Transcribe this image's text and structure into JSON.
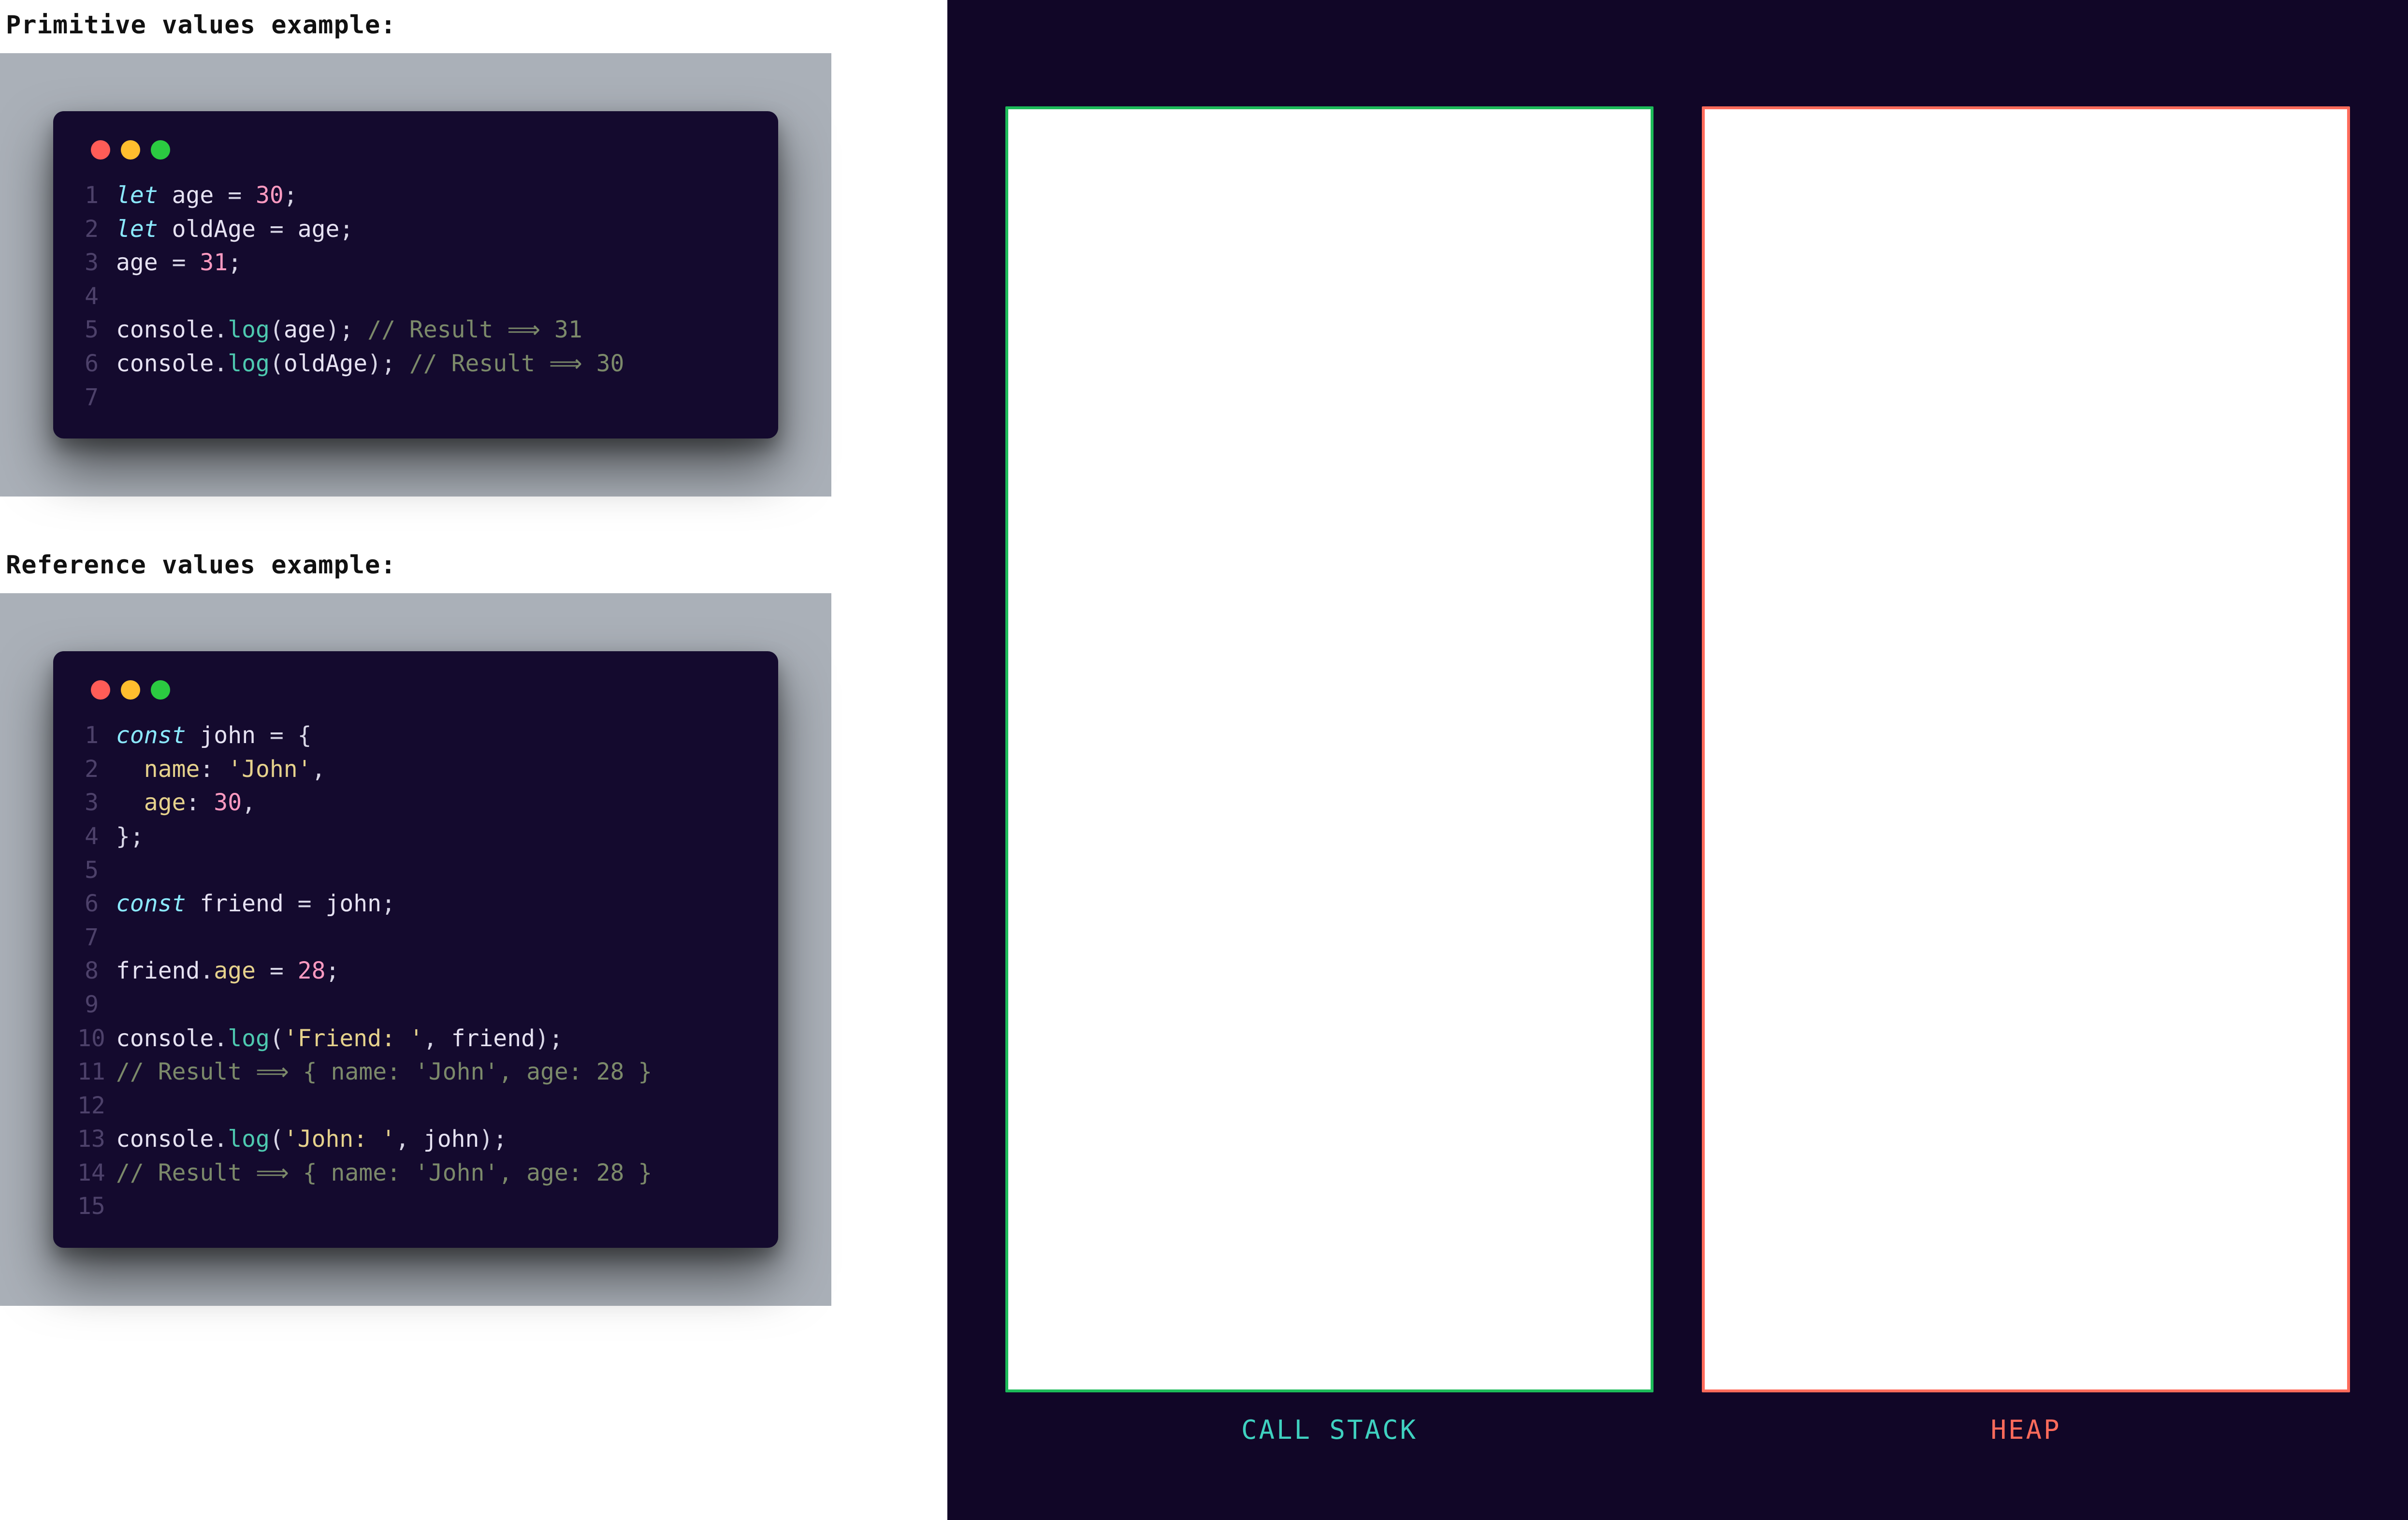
{
  "section1": {
    "title": "Primitive values example:"
  },
  "section2": {
    "title": "Reference values example:"
  },
  "diagram": {
    "stack_label": "CALL STACK",
    "heap_label": "HEAP"
  },
  "code1": {
    "lines": [
      {
        "n": "1",
        "tokens": [
          [
            "kw",
            "let "
          ],
          [
            "ident",
            "age"
          ],
          [
            "punc",
            " = "
          ],
          [
            "num",
            "30"
          ],
          [
            "punc",
            ";"
          ]
        ]
      },
      {
        "n": "2",
        "tokens": [
          [
            "kw",
            "let "
          ],
          [
            "ident",
            "oldAge"
          ],
          [
            "punc",
            " = "
          ],
          [
            "ident",
            "age"
          ],
          [
            "punc",
            ";"
          ]
        ]
      },
      {
        "n": "3",
        "tokens": [
          [
            "ident",
            "age"
          ],
          [
            "punc",
            " = "
          ],
          [
            "num",
            "31"
          ],
          [
            "punc",
            ";"
          ]
        ]
      },
      {
        "n": "4",
        "tokens": []
      },
      {
        "n": "5",
        "tokens": [
          [
            "ident",
            "console"
          ],
          [
            "punc",
            "."
          ],
          [
            "fn",
            "log"
          ],
          [
            "punc",
            "("
          ],
          [
            "ident",
            "age"
          ],
          [
            "punc",
            "); "
          ],
          [
            "cmt",
            "// Result "
          ],
          [
            "arrow",
            "⟹"
          ],
          [
            "cmt",
            " 31"
          ]
        ]
      },
      {
        "n": "6",
        "tokens": [
          [
            "ident",
            "console"
          ],
          [
            "punc",
            "."
          ],
          [
            "fn",
            "log"
          ],
          [
            "punc",
            "("
          ],
          [
            "ident",
            "oldAge"
          ],
          [
            "punc",
            "); "
          ],
          [
            "cmt",
            "// Result "
          ],
          [
            "arrow",
            "⟹"
          ],
          [
            "cmt",
            " 30"
          ]
        ]
      },
      {
        "n": "7",
        "tokens": []
      }
    ]
  },
  "code2": {
    "lines": [
      {
        "n": "1",
        "tokens": [
          [
            "kw",
            "const "
          ],
          [
            "ident",
            "john"
          ],
          [
            "punc",
            " = {"
          ]
        ]
      },
      {
        "n": "2",
        "tokens": [
          [
            "punc",
            "  "
          ],
          [
            "prop",
            "name"
          ],
          [
            "punc",
            ": "
          ],
          [
            "str",
            "'John'"
          ],
          [
            "punc",
            ","
          ]
        ]
      },
      {
        "n": "3",
        "tokens": [
          [
            "punc",
            "  "
          ],
          [
            "prop",
            "age"
          ],
          [
            "punc",
            ": "
          ],
          [
            "num",
            "30"
          ],
          [
            "punc",
            ","
          ]
        ]
      },
      {
        "n": "4",
        "tokens": [
          [
            "punc",
            "};"
          ]
        ]
      },
      {
        "n": "5",
        "tokens": []
      },
      {
        "n": "6",
        "tokens": [
          [
            "kw",
            "const "
          ],
          [
            "ident",
            "friend"
          ],
          [
            "punc",
            " = "
          ],
          [
            "ident",
            "john"
          ],
          [
            "punc",
            ";"
          ]
        ]
      },
      {
        "n": "7",
        "tokens": []
      },
      {
        "n": "8",
        "tokens": [
          [
            "ident",
            "friend"
          ],
          [
            "punc",
            "."
          ],
          [
            "prop",
            "age"
          ],
          [
            "punc",
            " = "
          ],
          [
            "num",
            "28"
          ],
          [
            "punc",
            ";"
          ]
        ]
      },
      {
        "n": "9",
        "tokens": []
      },
      {
        "n": "10",
        "tokens": [
          [
            "ident",
            "console"
          ],
          [
            "punc",
            "."
          ],
          [
            "fn",
            "log"
          ],
          [
            "punc",
            "("
          ],
          [
            "str",
            "'Friend: '"
          ],
          [
            "punc",
            ", "
          ],
          [
            "ident",
            "friend"
          ],
          [
            "punc",
            ");"
          ]
        ]
      },
      {
        "n": "11",
        "tokens": [
          [
            "cmt",
            "// Result "
          ],
          [
            "arrow",
            "⟹"
          ],
          [
            "cmt",
            " { name: 'John', age: 28 }"
          ]
        ]
      },
      {
        "n": "12",
        "tokens": []
      },
      {
        "n": "13",
        "tokens": [
          [
            "ident",
            "console"
          ],
          [
            "punc",
            "."
          ],
          [
            "fn",
            "log"
          ],
          [
            "punc",
            "("
          ],
          [
            "str",
            "'John: '"
          ],
          [
            "punc",
            ", "
          ],
          [
            "ident",
            "john"
          ],
          [
            "punc",
            ");"
          ]
        ]
      },
      {
        "n": "14",
        "tokens": [
          [
            "cmt",
            "// Result "
          ],
          [
            "arrow",
            "⟹"
          ],
          [
            "cmt",
            " { name: 'John', age: 28 }"
          ]
        ]
      },
      {
        "n": "15",
        "tokens": []
      }
    ]
  }
}
